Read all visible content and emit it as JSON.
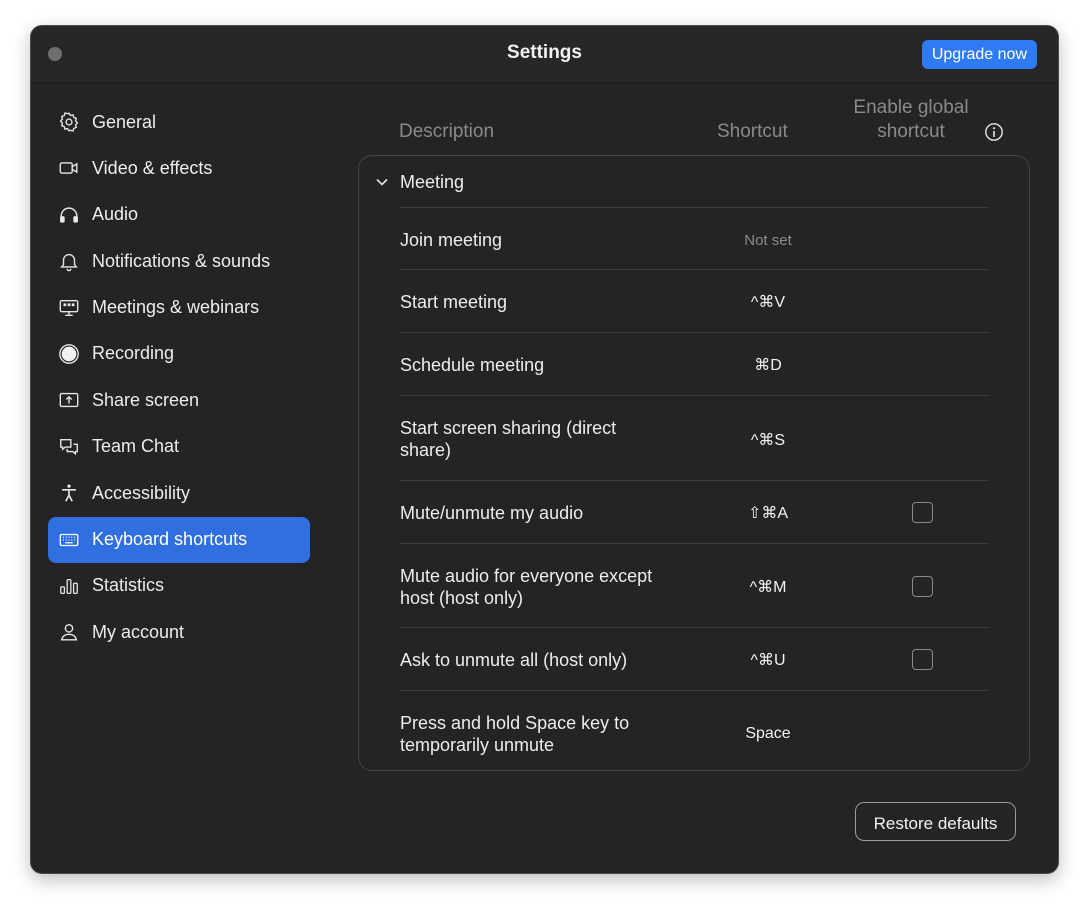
{
  "window": {
    "title": "Settings",
    "upgrade_label": "Upgrade now"
  },
  "sidebar": {
    "items": [
      {
        "label": "General",
        "icon": "gear-icon"
      },
      {
        "label": "Video & effects",
        "icon": "video-camera-icon"
      },
      {
        "label": "Audio",
        "icon": "headphones-icon"
      },
      {
        "label": "Notifications & sounds",
        "icon": "bell-icon"
      },
      {
        "label": "Meetings & webinars",
        "icon": "meetings-icon"
      },
      {
        "label": "Recording",
        "icon": "record-icon"
      },
      {
        "label": "Share screen",
        "icon": "share-screen-icon"
      },
      {
        "label": "Team Chat",
        "icon": "chat-bubbles-icon"
      },
      {
        "label": "Accessibility",
        "icon": "accessibility-icon"
      },
      {
        "label": "Keyboard shortcuts",
        "icon": "keyboard-icon",
        "active": true
      },
      {
        "label": "Statistics",
        "icon": "bar-chart-icon"
      },
      {
        "label": "My account",
        "icon": "person-icon"
      }
    ]
  },
  "table": {
    "headers": {
      "description": "Description",
      "shortcut": "Shortcut",
      "global_line1": "Enable global",
      "global_line2": "shortcut"
    },
    "section": "Meeting",
    "rows": [
      {
        "description": "Join meeting",
        "shortcut": "Not set",
        "has_checkbox": false,
        "checked": false
      },
      {
        "description": "Start meeting",
        "shortcut": "^⌘V",
        "has_checkbox": false,
        "checked": false
      },
      {
        "description": "Schedule meeting",
        "shortcut": "⌘D",
        "has_checkbox": false,
        "checked": false
      },
      {
        "description": "Start screen sharing (direct share)",
        "shortcut": "^⌘S",
        "has_checkbox": false,
        "checked": false
      },
      {
        "description": "Mute/unmute my audio",
        "shortcut": "⇧⌘A",
        "has_checkbox": true,
        "checked": false
      },
      {
        "description": "Mute audio for everyone except host (host only)",
        "shortcut": "^⌘M",
        "has_checkbox": true,
        "checked": false
      },
      {
        "description": "Ask to unmute all (host only)",
        "shortcut": "^⌘U",
        "has_checkbox": true,
        "checked": false
      },
      {
        "description": "Press and hold Space key to temporarily unmute",
        "shortcut": "Space",
        "has_checkbox": false,
        "checked": false
      }
    ]
  },
  "footer": {
    "restore_label": "Restore defaults"
  },
  "colors": {
    "accent": "#2f7bf3",
    "active_item": "#2f6fe0",
    "window_bg": "#242425"
  }
}
